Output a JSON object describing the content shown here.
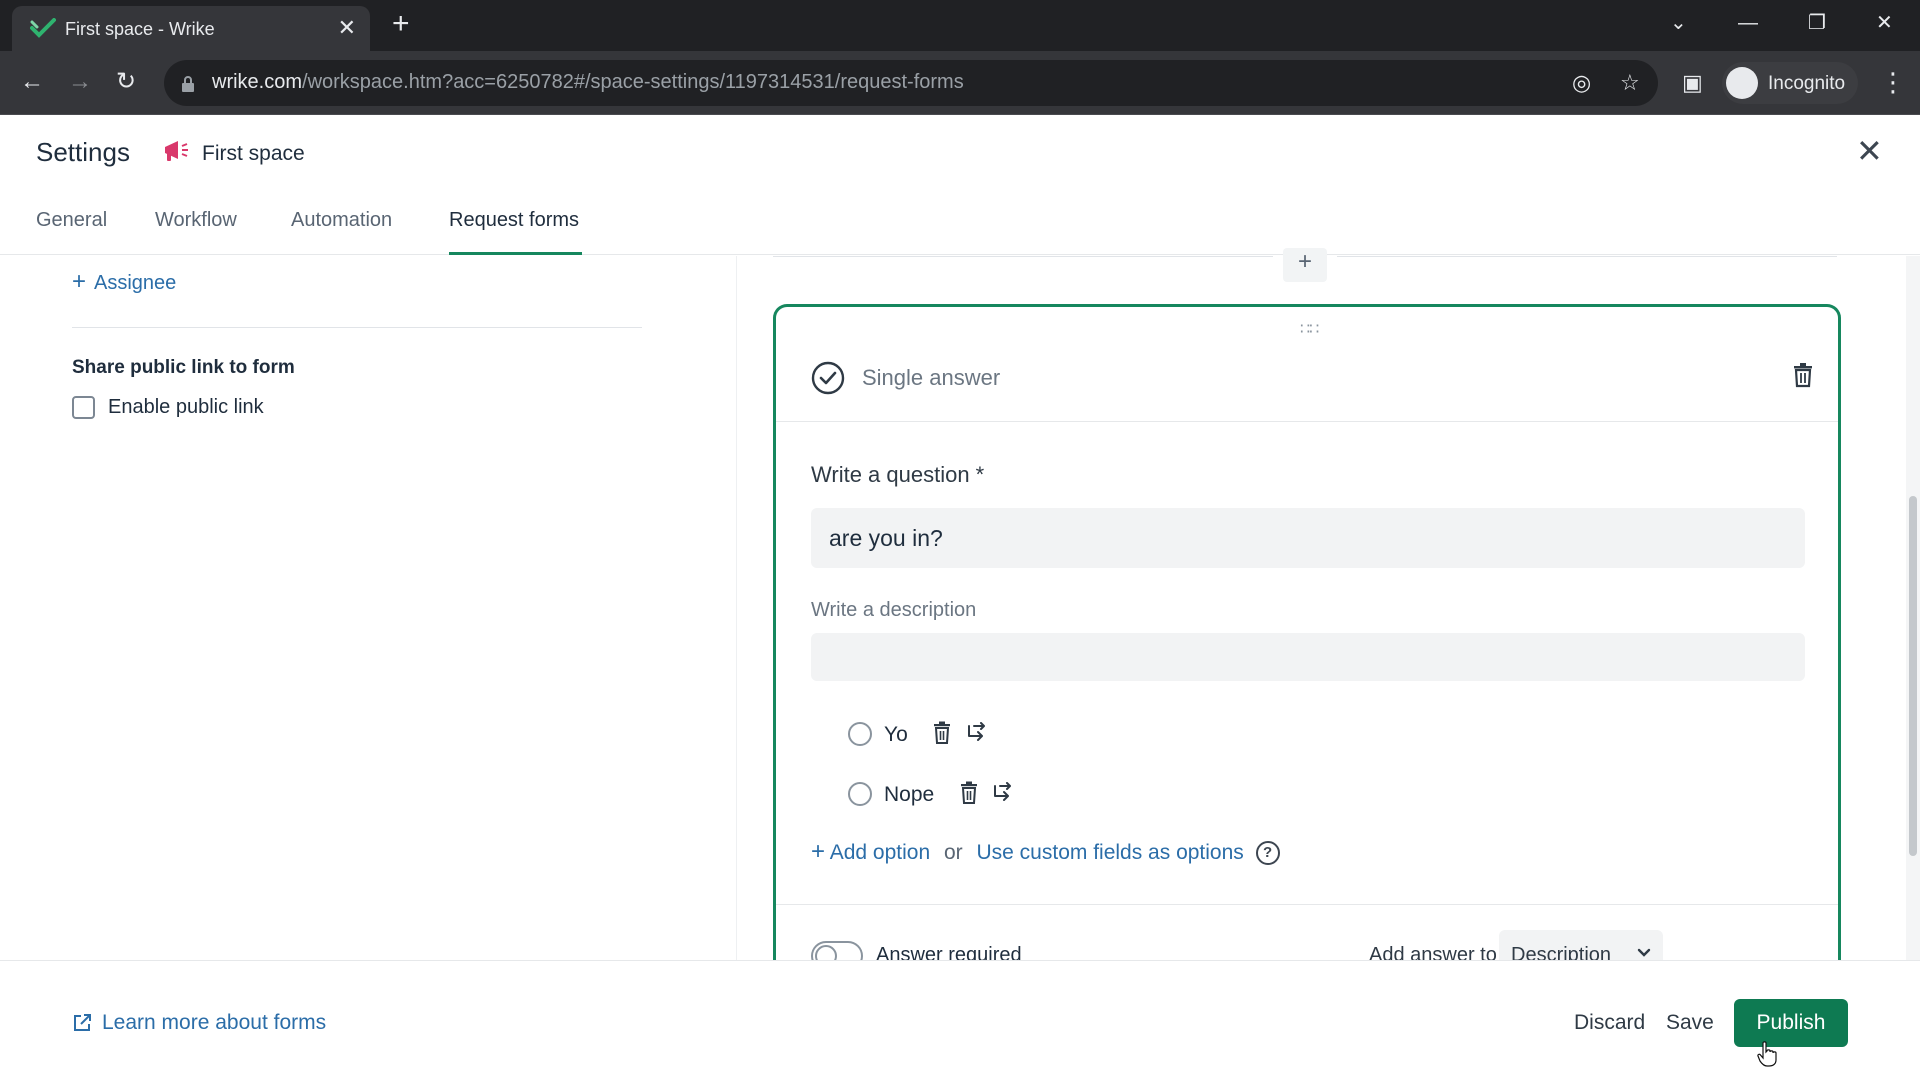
{
  "browser": {
    "tab_title": "First space - Wrike",
    "url_host": "wrike.com",
    "url_path": "/workspace.htm?acc=6250782#/space-settings/1197314531/request-forms",
    "profile_label": "Incognito"
  },
  "header": {
    "title": "Settings",
    "space_name": "First space",
    "tabs": [
      {
        "label": "General"
      },
      {
        "label": "Workflow"
      },
      {
        "label": "Automation"
      },
      {
        "label": "Request forms",
        "active": true
      }
    ]
  },
  "left_panel": {
    "assignee_label": "Assignee",
    "share_title": "Share public link to form",
    "enable_public_link": "Enable public link"
  },
  "question_card": {
    "type_label": "Single answer",
    "question_label": "Write a question *",
    "question_value": "are you in?",
    "description_label": "Write a description",
    "description_value": "",
    "options": [
      {
        "label": "Yo"
      },
      {
        "label": "Nope"
      }
    ],
    "add_option": "Add option",
    "or_text": "or",
    "custom_fields_link": "Use custom fields as options",
    "help_glyph": "?",
    "answer_required": "Answer required",
    "add_answer_to": "Add answer to",
    "add_answer_target": "Description"
  },
  "footer": {
    "learn_more": "Learn more about forms",
    "discard": "Discard",
    "save": "Save",
    "publish": "Publish"
  },
  "colors": {
    "accent_green": "#16875e",
    "publish_bg": "#0e7a52",
    "link_blue": "#2b6da8",
    "space_icon": "#d9386b"
  }
}
